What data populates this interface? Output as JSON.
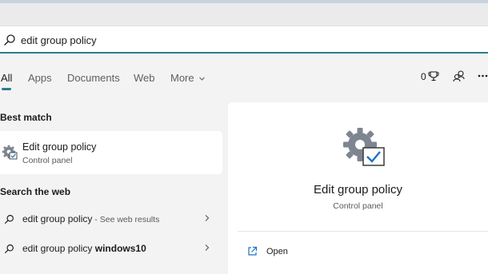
{
  "search": {
    "query": "edit group policy"
  },
  "tabs": [
    {
      "label": "All",
      "active": true
    },
    {
      "label": "Apps"
    },
    {
      "label": "Documents"
    },
    {
      "label": "Web"
    },
    {
      "label": "More"
    }
  ],
  "toolbar": {
    "points": "0",
    "points_icon": "trophy-icon",
    "account_icon": "people-icon",
    "more_icon": "ellipsis-icon"
  },
  "best_match": {
    "heading": "Best match",
    "title": "Edit group policy",
    "subtitle": "Control panel",
    "icon": "settings-gear-check-icon"
  },
  "web": {
    "heading": "Search the web",
    "results": [
      {
        "query": "edit group policy",
        "suffix": " - See web results",
        "bold": ""
      },
      {
        "query": "edit group policy ",
        "suffix": "",
        "bold": "windows10"
      }
    ]
  },
  "preview": {
    "title": "Edit group policy",
    "subtitle": "Control panel",
    "action": "Open",
    "accent": "#2a7d8c"
  }
}
